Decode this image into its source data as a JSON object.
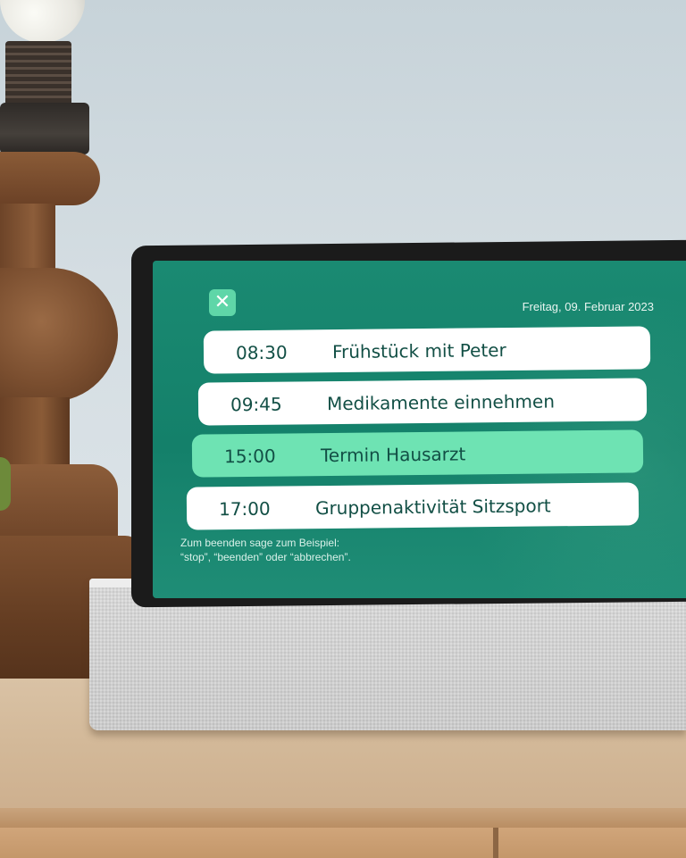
{
  "screen": {
    "date": "Freitag, 09. Februar 2023",
    "close_icon": "close-icon",
    "schedule": [
      {
        "time": "08:30",
        "label": "Frühstück mit Peter",
        "highlight": false
      },
      {
        "time": "09:45",
        "label": "Medikamente einnehmen",
        "highlight": false
      },
      {
        "time": "15:00",
        "label": "Termin Hausarzt",
        "highlight": true
      },
      {
        "time": "17:00",
        "label": "Gruppenaktivität Sitzsport",
        "highlight": false
      }
    ],
    "hint": {
      "line1": "Zum beenden sage zum Beispiel:",
      "line2": "“stop”, “beenden” oder “abbrechen”."
    }
  },
  "colors": {
    "screen_bg": "#14806a",
    "row_bg": "#ffffff",
    "row_highlight": "#6ee3b3",
    "close_button": "#5fd6a8",
    "text_dark": "#124f45"
  }
}
